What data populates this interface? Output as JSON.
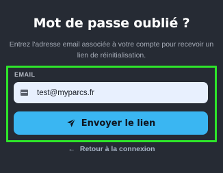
{
  "page": {
    "title": "Mot de passe oublié ?",
    "subtitle": "Entrez l'adresse email associée à votre compte pour recevoir un lien de réinitialisation."
  },
  "form": {
    "email_label": "EMAIL",
    "email_value": "test@myparcs.fr",
    "email_icon": "mail-icon",
    "submit_label": "Envoyer le lien",
    "submit_icon": "send-icon"
  },
  "footer": {
    "back_label": "Retour à la connexion",
    "back_icon": "arrow-left-icon"
  },
  "colors": {
    "background": "#262b34",
    "accent": "#3ab6f2",
    "highlight": "#2ee62a",
    "input_bg": "#e8f0fe"
  }
}
